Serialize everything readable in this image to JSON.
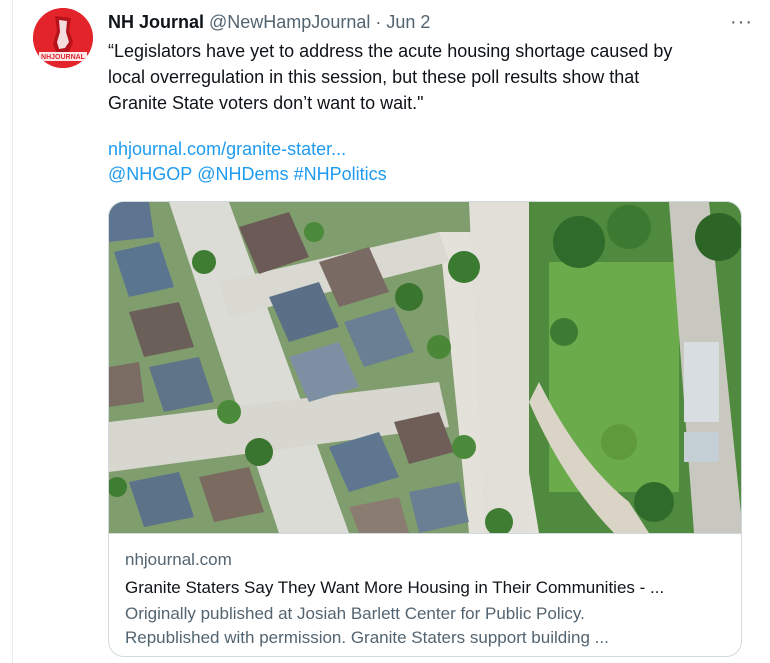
{
  "tweet": {
    "author_name": "NH Journal",
    "author_handle": "@NewHampJournal",
    "separator": "·",
    "date": "Jun 2",
    "more_label": "···",
    "avatar_text": "NHJOURNAL",
    "text_line_1": "“Legislators have yet to address the acute housing shortage caused by",
    "text_line_2": "local overregulation in this session, but these poll results show that",
    "text_line_3": "Granite State voters don’t want to wait.\"",
    "link_url": "nhjournal.com/granite-stater...",
    "mentions": [
      "@NHGOP",
      "@NHDems",
      "#NHPolitics"
    ]
  },
  "card": {
    "domain": "nhjournal.com",
    "title": "Granite Staters Say They Want More Housing in Their Communities - ...",
    "description_line_1": "Originally published at Josiah Barlett Center for Public Policy.",
    "description_line_2": "Republished with permission. Granite Staters support building ...",
    "image_subject": "aerial-neighborhood-photo"
  },
  "colors": {
    "link": "#1d9bf0",
    "secondary_text": "#536471",
    "primary_text": "#0f1419",
    "avatar_red": "#e3242b"
  }
}
